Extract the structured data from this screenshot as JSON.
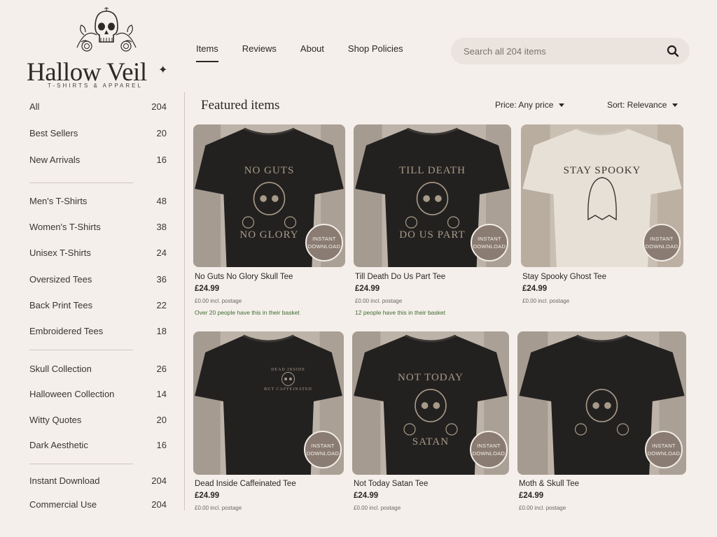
{
  "brand": {
    "name": "Hallow Veil",
    "tagline": "T-SHIRTS & APPAREL"
  },
  "nav": [
    {
      "label": "Items",
      "active": true
    },
    {
      "label": "Reviews",
      "active": false
    },
    {
      "label": "About",
      "active": false
    },
    {
      "label": "Shop Policies",
      "active": false
    }
  ],
  "search": {
    "placeholder": "Search all 204 items",
    "icon": "search-icon"
  },
  "sidebar": {
    "groups": [
      [
        {
          "label": "All",
          "count": "204"
        },
        {
          "label": "Best Sellers",
          "count": "20"
        },
        {
          "label": "New Arrivals",
          "count": "16"
        }
      ],
      [
        {
          "label": "Men's T-Shirts",
          "count": "48"
        },
        {
          "label": "Women's T-Shirts",
          "count": "38"
        },
        {
          "label": "Unisex T-Shirts",
          "count": "24"
        },
        {
          "label": "Oversized Tees",
          "count": "36"
        },
        {
          "label": "Back Print Tees",
          "count": "22"
        },
        {
          "label": "Embroidered Tees",
          "count": "18"
        }
      ],
      [
        {
          "label": "Skull Collection",
          "count": "26"
        },
        {
          "label": "Halloween Collection",
          "count": "14"
        },
        {
          "label": "Witty Quotes",
          "count": "20"
        },
        {
          "label": "Dark Aesthetic",
          "count": "16"
        }
      ],
      [
        {
          "label": "Instant Download",
          "count": "204"
        },
        {
          "label": "Commercial Use",
          "count": "204"
        }
      ]
    ]
  },
  "featured": {
    "title": "Featured items",
    "price_filter": "Price: Any price",
    "sort": "Sort: Relevance"
  },
  "badge": {
    "line1": "INSTANT",
    "line2": "DOWNLOAD"
  },
  "products": [
    {
      "name": "No Guts No Glory Skull Tee",
      "price": "£24.99",
      "postage": "£0.00 incl. postage",
      "basket": "Over 20 people have this in their basket",
      "print_top": "NO GUTS",
      "print_bottom": "NO GLORY",
      "shirt": "dark",
      "graphic": "skull"
    },
    {
      "name": "Till Death Do Us Part Tee",
      "price": "£24.99",
      "postage": "£0.00 incl. postage",
      "basket": "12 people have this in their basket",
      "print_top": "TILL DEATH",
      "print_bottom": "DO US PART",
      "shirt": "dark",
      "graphic": "reaper"
    },
    {
      "name": "Stay Spooky Ghost Tee",
      "price": "£24.99",
      "postage": "£0.00 incl. postage",
      "basket": "",
      "print_top": "STAY SPOOKY",
      "print_bottom": "",
      "shirt": "light",
      "graphic": "ghost"
    },
    {
      "name": "Dead Inside Caffeinated Tee",
      "price": "£24.99",
      "postage": "£0.00 incl. postage",
      "basket": "",
      "print_top": "DEAD INSIDE",
      "print_bottom": "BUT CAFFEINATED",
      "shirt": "dark",
      "graphic": "small-skull"
    },
    {
      "name": "Not Today Satan Tee",
      "price": "£24.99",
      "postage": "£0.00 incl. postage",
      "basket": "",
      "print_top": "NOT TODAY",
      "print_bottom": "SATAN",
      "shirt": "dark",
      "graphic": "skeleton"
    },
    {
      "name": "Moth & Skull Tee",
      "price": "£24.99",
      "postage": "£0.00 incl. postage",
      "basket": "",
      "print_top": "",
      "print_bottom": "",
      "shirt": "dark",
      "graphic": "moth-skull"
    }
  ]
}
